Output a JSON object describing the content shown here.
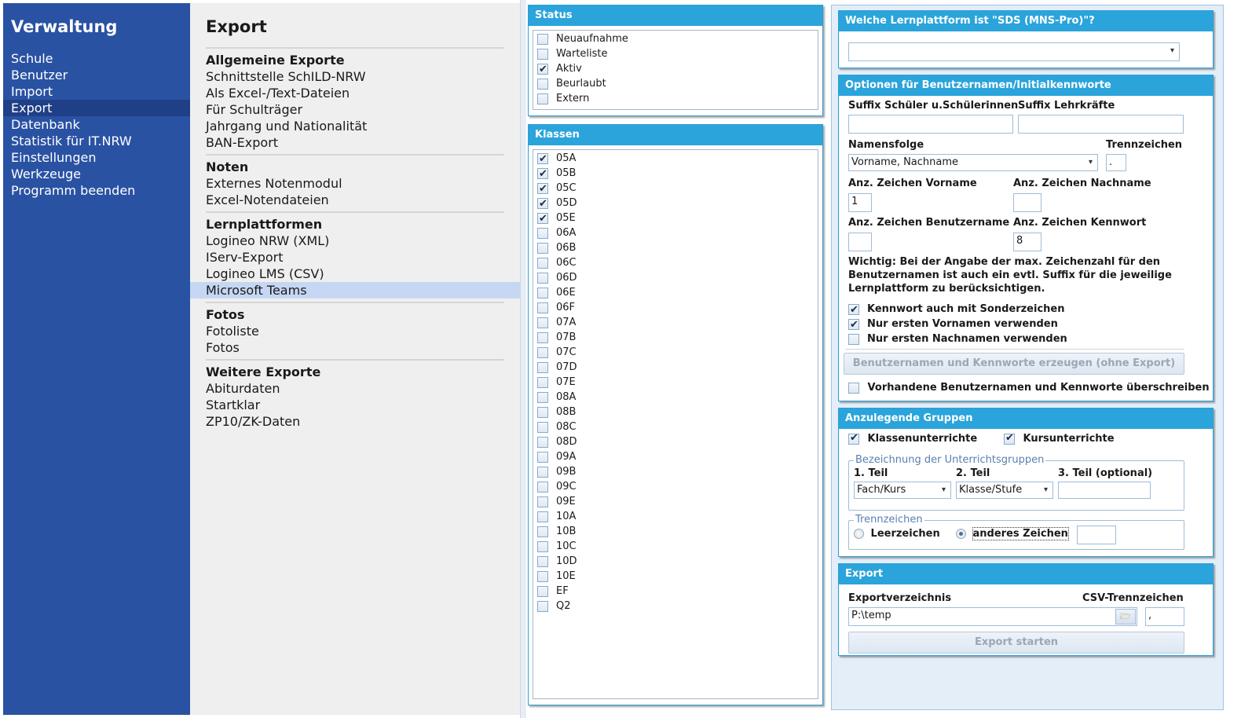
{
  "nav": {
    "title": "Verwaltung",
    "items": [
      "Schule",
      "Benutzer",
      "Import",
      "Export",
      "Datenbank",
      "Statistik für IT.NRW",
      "Einstellungen",
      "Werkzeuge",
      "Programm beenden"
    ],
    "active": "Export"
  },
  "menu": {
    "title": "Export",
    "groups": [
      {
        "label": "Allgemeine Exporte",
        "items": [
          "Schnittstelle SchILD-NRW",
          "Als Excel-/Text-Dateien",
          "Für Schulträger",
          "Jahrgang und Nationalität",
          "BAN-Export"
        ]
      },
      {
        "label": "Noten",
        "items": [
          "Externes Notenmodul",
          "Excel-Notendateien"
        ]
      },
      {
        "label": "Lernplattformen",
        "items": [
          "Logineo NRW (XML)",
          "IServ-Export",
          "Logineo LMS (CSV)",
          "Microsoft Teams"
        ]
      },
      {
        "label": "Fotos",
        "items": [
          "Fotoliste",
          "Fotos"
        ]
      },
      {
        "label": "Weitere Exporte",
        "items": [
          "Abiturdaten",
          "Startklar",
          "ZP10/ZK-Daten"
        ]
      }
    ],
    "active": "Microsoft Teams"
  },
  "status": {
    "title": "Status",
    "items": [
      {
        "label": "Neuaufnahme",
        "checked": false
      },
      {
        "label": "Warteliste",
        "checked": false
      },
      {
        "label": "Aktiv",
        "checked": true
      },
      {
        "label": "Beurlaubt",
        "checked": false
      },
      {
        "label": "Extern",
        "checked": false
      }
    ]
  },
  "klassen": {
    "title": "Klassen",
    "items": [
      {
        "label": "05A",
        "checked": true
      },
      {
        "label": "05B",
        "checked": true
      },
      {
        "label": "05C",
        "checked": true
      },
      {
        "label": "05D",
        "checked": true
      },
      {
        "label": "05E",
        "checked": true
      },
      {
        "label": "06A",
        "checked": false
      },
      {
        "label": "06B",
        "checked": false
      },
      {
        "label": "06C",
        "checked": false
      },
      {
        "label": "06D",
        "checked": false
      },
      {
        "label": "06E",
        "checked": false
      },
      {
        "label": "06F",
        "checked": false
      },
      {
        "label": "07A",
        "checked": false
      },
      {
        "label": "07B",
        "checked": false
      },
      {
        "label": "07C",
        "checked": false
      },
      {
        "label": "07D",
        "checked": false
      },
      {
        "label": "07E",
        "checked": false
      },
      {
        "label": "08A",
        "checked": false
      },
      {
        "label": "08B",
        "checked": false
      },
      {
        "label": "08C",
        "checked": false
      },
      {
        "label": "08D",
        "checked": false
      },
      {
        "label": "09A",
        "checked": false
      },
      {
        "label": "09B",
        "checked": false
      },
      {
        "label": "09C",
        "checked": false
      },
      {
        "label": "09E",
        "checked": false
      },
      {
        "label": "10A",
        "checked": false
      },
      {
        "label": "10B",
        "checked": false
      },
      {
        "label": "10C",
        "checked": false
      },
      {
        "label": "10D",
        "checked": false
      },
      {
        "label": "10E",
        "checked": false
      },
      {
        "label": "EF",
        "checked": false
      },
      {
        "label": "Q2",
        "checked": false
      }
    ]
  },
  "plattform": {
    "title": "Welche Lernplattform ist \"SDS (MNS-Pro)\"?",
    "value": ""
  },
  "optionen": {
    "title": "Optionen für Benutzernamen/Initialkennworte",
    "suffix_schueler_label": "Suffix Schüler u.Schülerinnen",
    "suffix_schueler_value": "",
    "suffix_lehrer_label": "Suffix Lehrkräfte",
    "suffix_lehrer_value": "",
    "namensfolge_label": "Namensfolge",
    "namensfolge_value": "Vorname, Nachname",
    "trennzeichen_label": "Trennzeichen",
    "trennzeichen_value": ".",
    "anz_vorname_label": "Anz. Zeichen Vorname",
    "anz_vorname_value": "1",
    "anz_nachname_label": "Anz. Zeichen Nachname",
    "anz_nachname_value": "",
    "anz_benutzername_label": "Anz. Zeichen Benutzername",
    "anz_benutzername_value": "",
    "anz_kennwort_label": "Anz. Zeichen Kennwort",
    "anz_kennwort_value": "8",
    "hinweis_1": "Wichtig: Bei der Angabe der max. Zeichenzahl für den",
    "hinweis_2": "Benutzernamen ist auch ein evtl. Suffix für die jeweilige",
    "hinweis_3": "Lernplattform zu berücksichtigen.",
    "checks": [
      {
        "label": "Kennwort auch mit Sonderzeichen",
        "checked": true
      },
      {
        "label": "Nur ersten Vornamen verwenden",
        "checked": true
      },
      {
        "label": "Nur ersten Nachnamen verwenden",
        "checked": false
      }
    ],
    "erzeugen_button": "Benutzernamen und Kennworte erzeugen (ohne Export)",
    "ueberschreiben_label": "Vorhandene Benutzernamen und Kennworte überschreiben",
    "ueberschreiben_checked": false
  },
  "gruppen": {
    "title": "Anzulegende Gruppen",
    "klassenunterrichte_label": "Klassenunterrichte",
    "klassenunterrichte_checked": true,
    "kursunterrichte_label": "Kursunterrichte",
    "kursunterrichte_checked": true,
    "bezeichnung_legend": "Bezeichnung der Unterrichtsgruppen",
    "teil1_label": "1. Teil",
    "teil1_value": "Fach/Kurs",
    "teil2_label": "2. Teil",
    "teil2_value": "Klasse/Stufe",
    "teil3_label": "3. Teil (optional)",
    "teil3_value": "",
    "trennzeichen_legend": "Trennzeichen",
    "leerzeichen_label": "Leerzeichen",
    "anderes_label": "anderes Zeichen",
    "anderes_value": "",
    "selected": "anderes Zeichen"
  },
  "export": {
    "title": "Export",
    "verzeichnis_label": "Exportverzeichnis",
    "verzeichnis_value": "P:\\temp",
    "csv_label": "CSV-Trennzeichen",
    "csv_value": ",",
    "start_button": "Export starten"
  },
  "icons": {
    "folder": "folder-icon",
    "check": "checkmark-icon",
    "dropdown": "chevron-down-icon"
  },
  "colors": {
    "nav_bg": "#2a52a3",
    "nav_active": "#1f3f86",
    "panel_header": "#2aa4db",
    "menu_active": "#c5d7f2"
  }
}
